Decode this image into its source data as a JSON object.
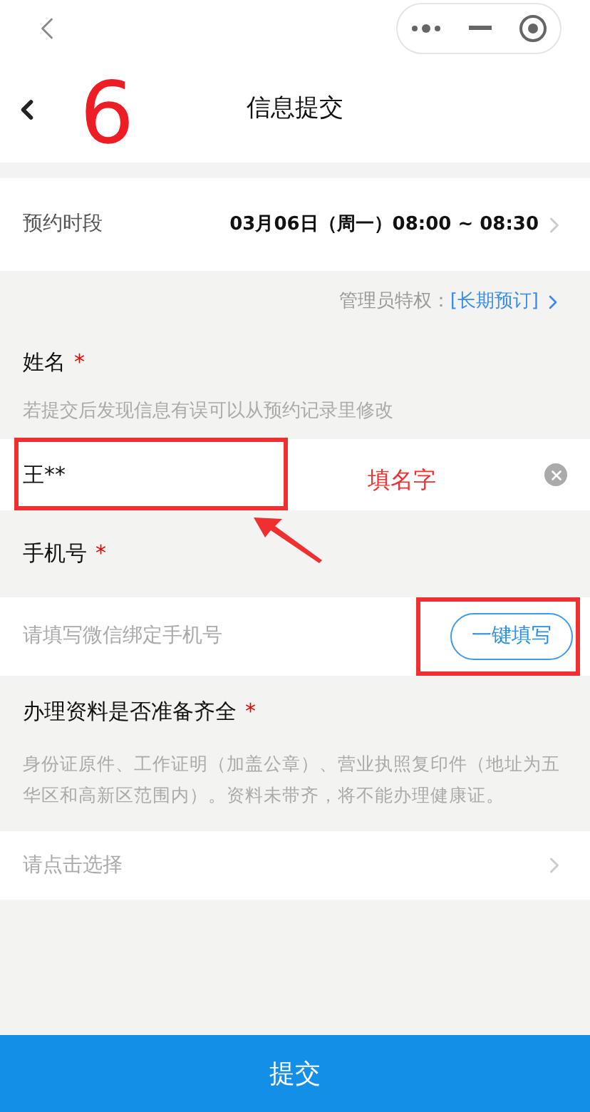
{
  "nav_bar": {
    "title": "信息提交"
  },
  "appointment": {
    "label": "预约时段",
    "value": "03月06日（周一）08:00 ~ 08:30"
  },
  "admin": {
    "label": "管理员特权：",
    "link": "[长期预订]"
  },
  "name_field": {
    "label": "姓名",
    "required": "*",
    "hint": "若提交后发现信息有误可以从预约记录里修改",
    "value": "王**"
  },
  "phone_field": {
    "label": "手机号",
    "required": "*",
    "placeholder": "请填写微信绑定手机号",
    "button": "一键填写"
  },
  "documents_field": {
    "label": "办理资料是否准备齐全",
    "required": "*",
    "description": "身份证原件、工作证明（加盖公章）、营业执照复印件（地址为五华区和高新区范围内）。资料未带齐，将不能办理健康证。",
    "placeholder": "请点击选择"
  },
  "submit_button": "提交",
  "annotations": [
    {
      "kind": "number",
      "text": "6"
    },
    {
      "kind": "name-box"
    },
    {
      "kind": "note",
      "text": "填名字"
    },
    {
      "kind": "arrow"
    },
    {
      "kind": "button-box"
    }
  ]
}
